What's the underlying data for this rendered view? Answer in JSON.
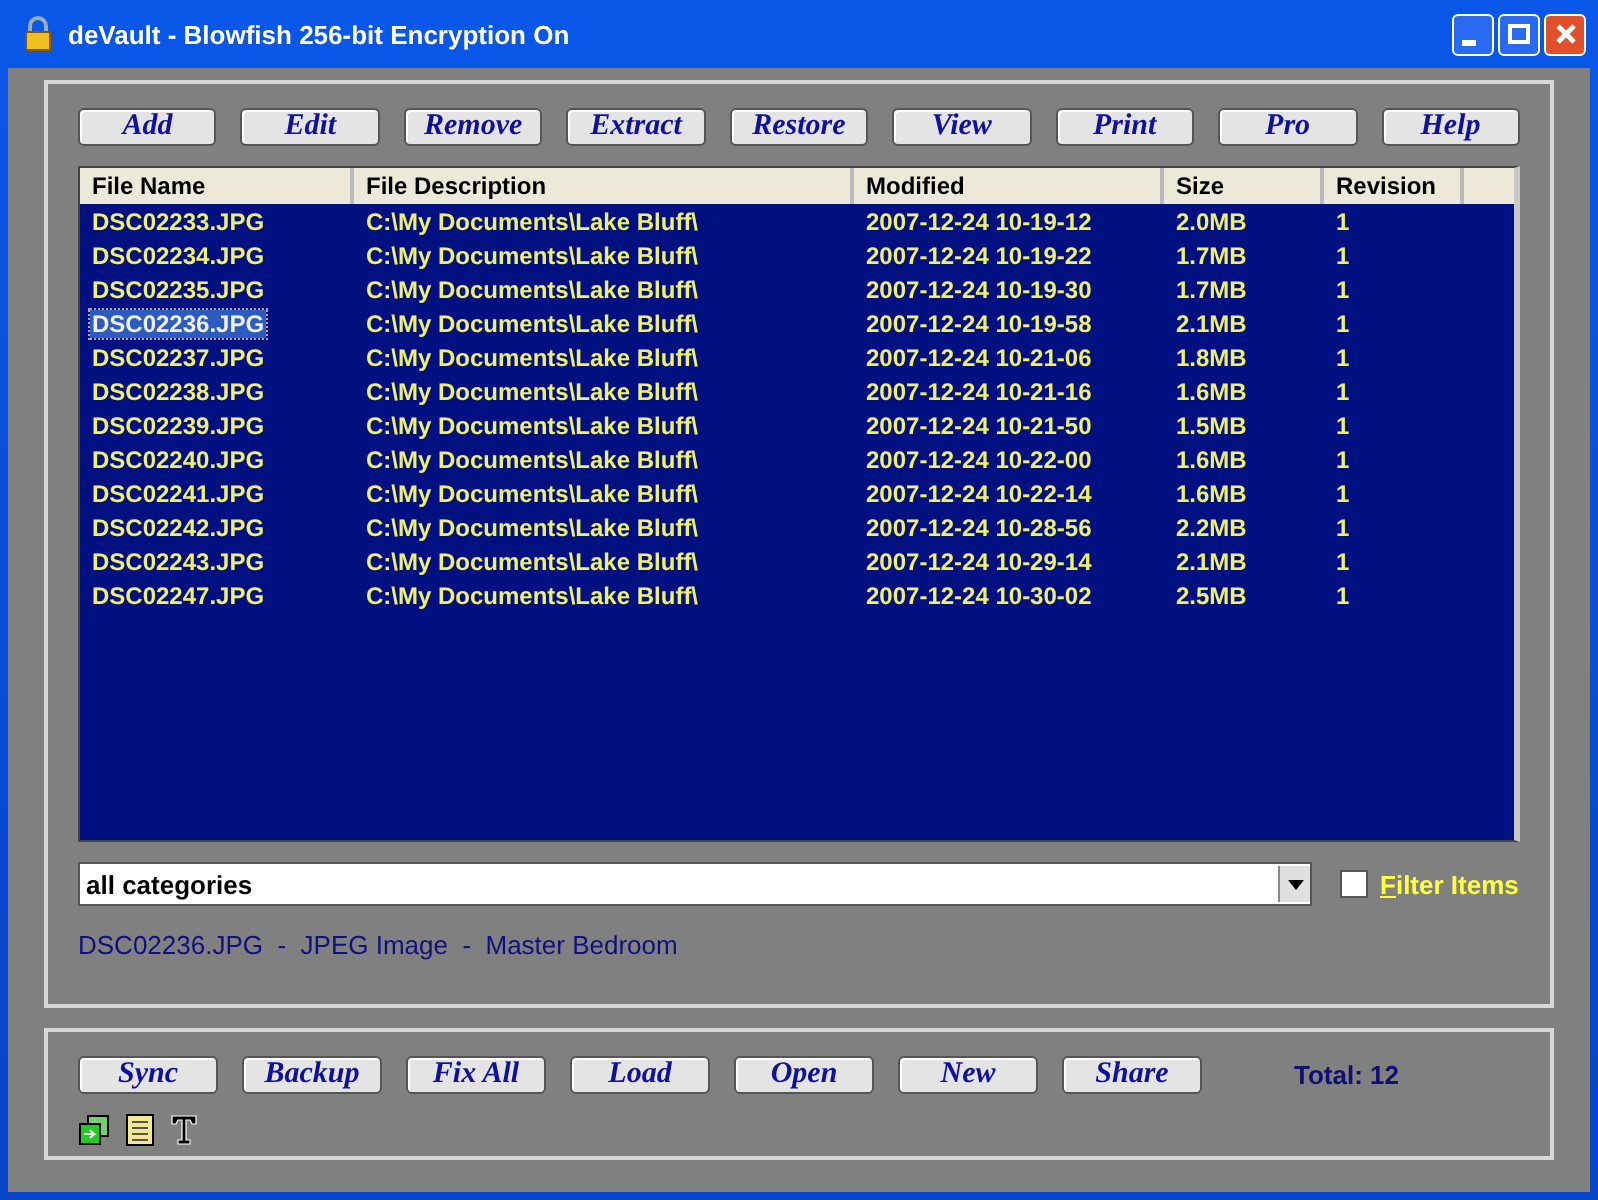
{
  "window": {
    "title": "deVault - Blowfish 256-bit Encryption On"
  },
  "toolbar": [
    "Add",
    "Edit",
    "Remove",
    "Extract",
    "Restore",
    "View",
    "Print",
    "Pro",
    "Help"
  ],
  "table": {
    "columns": [
      "File Name",
      "File Description",
      "Modified",
      "Size",
      "Revision"
    ],
    "rows": [
      {
        "cells": [
          "DSC02233.JPG",
          "C:\\My Documents\\Lake Bluff\\",
          "2007-12-24 10-19-12",
          "2.0MB",
          "1"
        ],
        "selected": false
      },
      {
        "cells": [
          "DSC02234.JPG",
          "C:\\My Documents\\Lake Bluff\\",
          "2007-12-24 10-19-22",
          "1.7MB",
          "1"
        ],
        "selected": false
      },
      {
        "cells": [
          "DSC02235.JPG",
          "C:\\My Documents\\Lake Bluff\\",
          "2007-12-24 10-19-30",
          "1.7MB",
          "1"
        ],
        "selected": false
      },
      {
        "cells": [
          "DSC02236.JPG",
          "C:\\My Documents\\Lake Bluff\\",
          "2007-12-24 10-19-58",
          "2.1MB",
          "1"
        ],
        "selected": true
      },
      {
        "cells": [
          "DSC02237.JPG",
          "C:\\My Documents\\Lake Bluff\\",
          "2007-12-24 10-21-06",
          "1.8MB",
          "1"
        ],
        "selected": false
      },
      {
        "cells": [
          "DSC02238.JPG",
          "C:\\My Documents\\Lake Bluff\\",
          "2007-12-24 10-21-16",
          "1.6MB",
          "1"
        ],
        "selected": false
      },
      {
        "cells": [
          "DSC02239.JPG",
          "C:\\My Documents\\Lake Bluff\\",
          "2007-12-24 10-21-50",
          "1.5MB",
          "1"
        ],
        "selected": false
      },
      {
        "cells": [
          "DSC02240.JPG",
          "C:\\My Documents\\Lake Bluff\\",
          "2007-12-24 10-22-00",
          "1.6MB",
          "1"
        ],
        "selected": false
      },
      {
        "cells": [
          "DSC02241.JPG",
          "C:\\My Documents\\Lake Bluff\\",
          "2007-12-24 10-22-14",
          "1.6MB",
          "1"
        ],
        "selected": false
      },
      {
        "cells": [
          "DSC02242.JPG",
          "C:\\My Documents\\Lake Bluff\\",
          "2007-12-24 10-28-56",
          "2.2MB",
          "1"
        ],
        "selected": false
      },
      {
        "cells": [
          "DSC02243.JPG",
          "C:\\My Documents\\Lake Bluff\\",
          "2007-12-24 10-29-14",
          "2.1MB",
          "1"
        ],
        "selected": false
      },
      {
        "cells": [
          "DSC02247.JPG",
          "C:\\My Documents\\Lake Bluff\\",
          "2007-12-24 10-30-02",
          "2.5MB",
          "1"
        ],
        "selected": false
      }
    ]
  },
  "category": {
    "value": "all categories"
  },
  "filter": {
    "label": "Filter Items",
    "checked": false
  },
  "details": "DSC02236.JPG  -  JPEG Image  -  Master Bedroom",
  "bottom_buttons": [
    "Sync",
    "Backup",
    "Fix All",
    "Load",
    "Open",
    "New",
    "Share"
  ],
  "total": "Total: 12"
}
